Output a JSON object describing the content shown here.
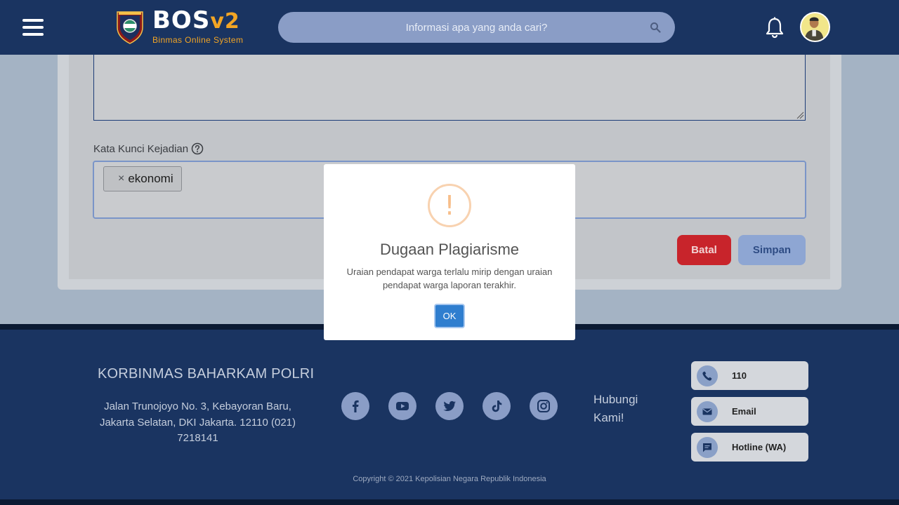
{
  "header": {
    "logo_title": "BOS",
    "logo_version": "v2",
    "logo_subtitle": "Binmas Online System",
    "search_placeholder": "Informasi apa yang anda cari?"
  },
  "form": {
    "keyword_label": "Kata Kunci Kejadian",
    "tags": [
      "ekonomi"
    ],
    "tag_remove_glyph": "×",
    "cancel_label": "Batal",
    "save_label": "Simpan"
  },
  "footer": {
    "org_name": "KORBINMAS BAHARKAM POLRI",
    "address": "Jalan Trunojoyo No. 3, Kebayoran Baru, Jakarta Selatan, DKI Jakarta. 12110 (021) 7218141",
    "social_icons": [
      "facebook-icon",
      "youtube-icon",
      "twitter-icon",
      "tiktok-icon",
      "instagram-icon"
    ],
    "contact_heading": "Hubungi Kami!",
    "contacts": [
      {
        "icon": "phone-icon",
        "label": "110"
      },
      {
        "icon": "mail-icon",
        "label": "Email"
      },
      {
        "icon": "chat-icon",
        "label": "Hotline (WA)"
      }
    ],
    "copyright": "Copyright © 2021 Kepolisian Negara Republik Indonesia"
  },
  "modal": {
    "icon": "warning-icon",
    "icon_glyph": "!",
    "title": "Dugaan Plagiarisme",
    "message": "Uraian pendapat warga terlalu mirip dengan uraian pendapat warga laporan terakhir.",
    "ok_label": "OK"
  },
  "colors": {
    "header_bg": "#1a3461",
    "accent_orange": "#f3a524",
    "danger": "#c8242b",
    "primary": "#2f7ecf",
    "warning_icon": "#f7be8a"
  }
}
